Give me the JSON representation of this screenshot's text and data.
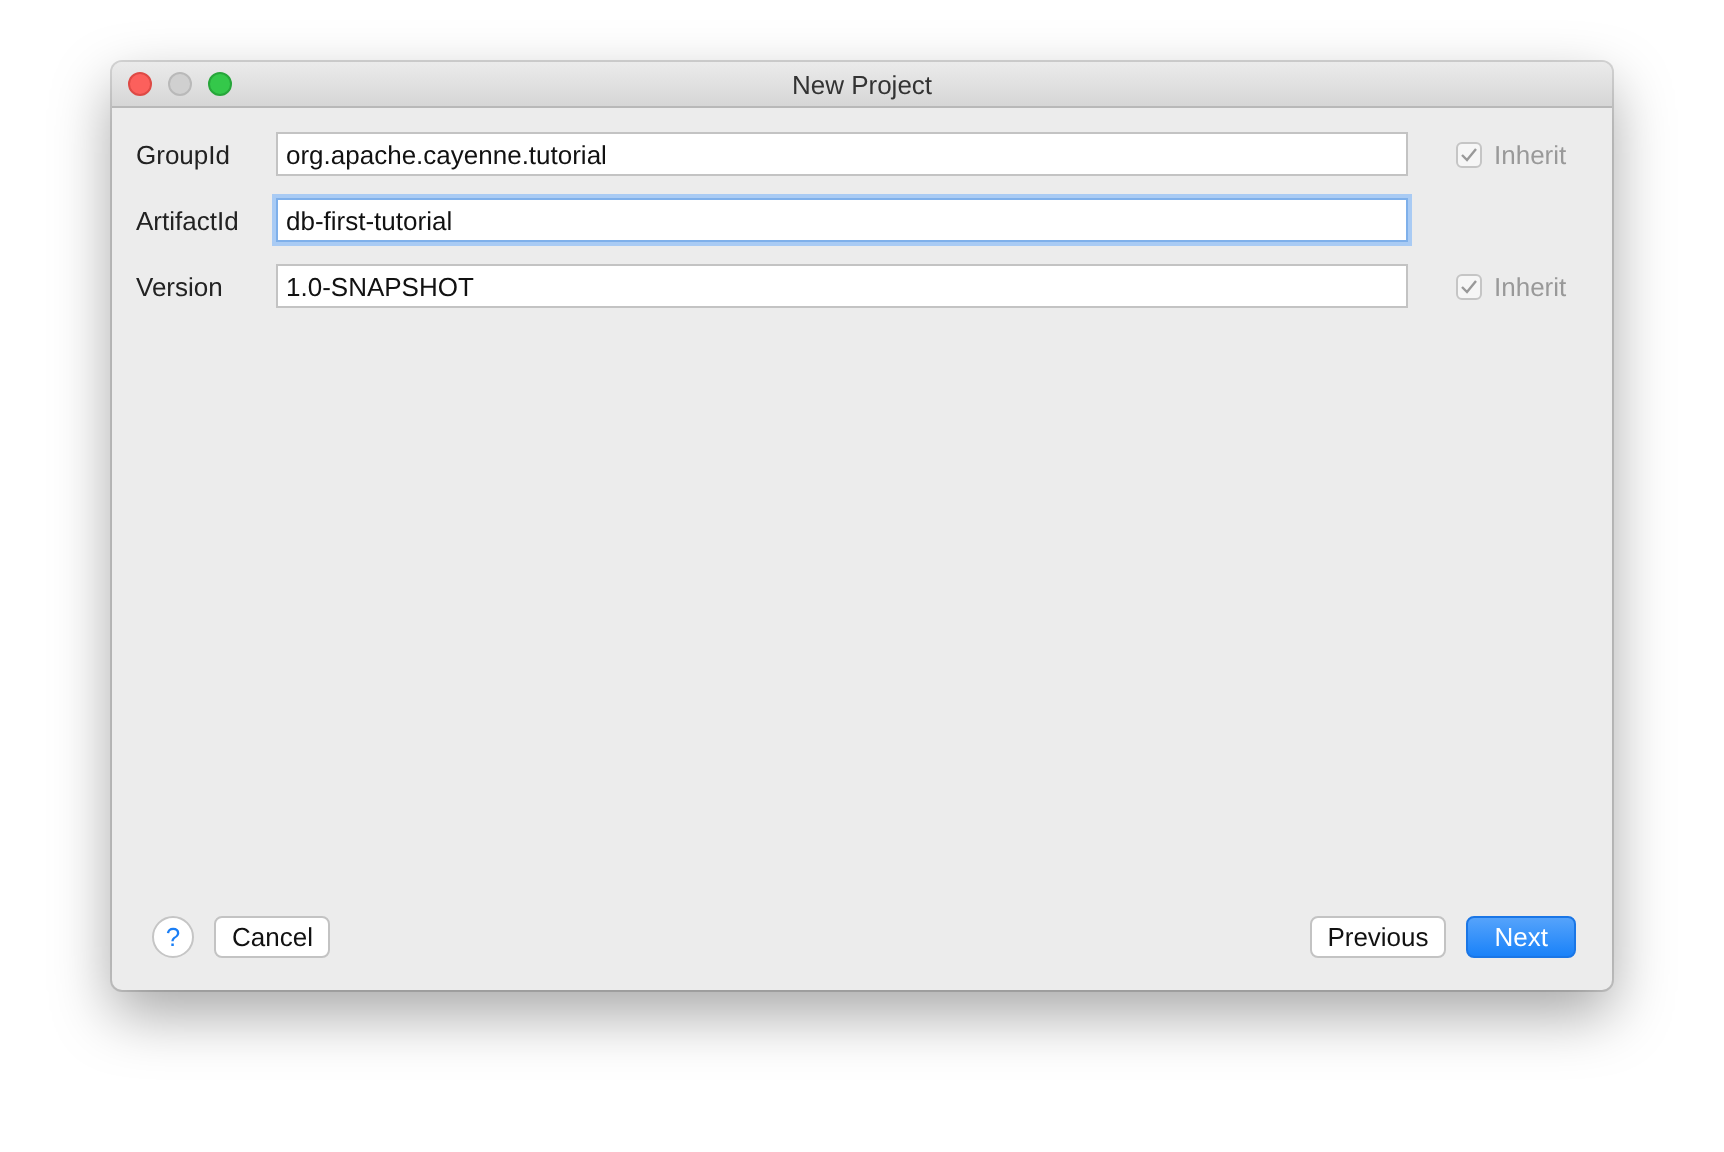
{
  "window": {
    "title": "New Project"
  },
  "fields": [
    {
      "label": "GroupId",
      "value": "org.apache.cayenne.tutorial",
      "focused": false,
      "inherit": {
        "label": "Inherit",
        "checked": true,
        "disabled": true
      }
    },
    {
      "label": "ArtifactId",
      "value": "db-first-tutorial",
      "focused": true
    },
    {
      "label": "Version",
      "value": "1.0-SNAPSHOT",
      "focused": false,
      "inherit": {
        "label": "Inherit",
        "checked": true,
        "disabled": true
      }
    }
  ],
  "help_button": "?",
  "left_buttons": [
    {
      "label": "Cancel",
      "kind": "normal"
    }
  ],
  "right_buttons": [
    {
      "label": "Previous",
      "kind": "normal"
    },
    {
      "label": "Next",
      "kind": "default"
    }
  ]
}
